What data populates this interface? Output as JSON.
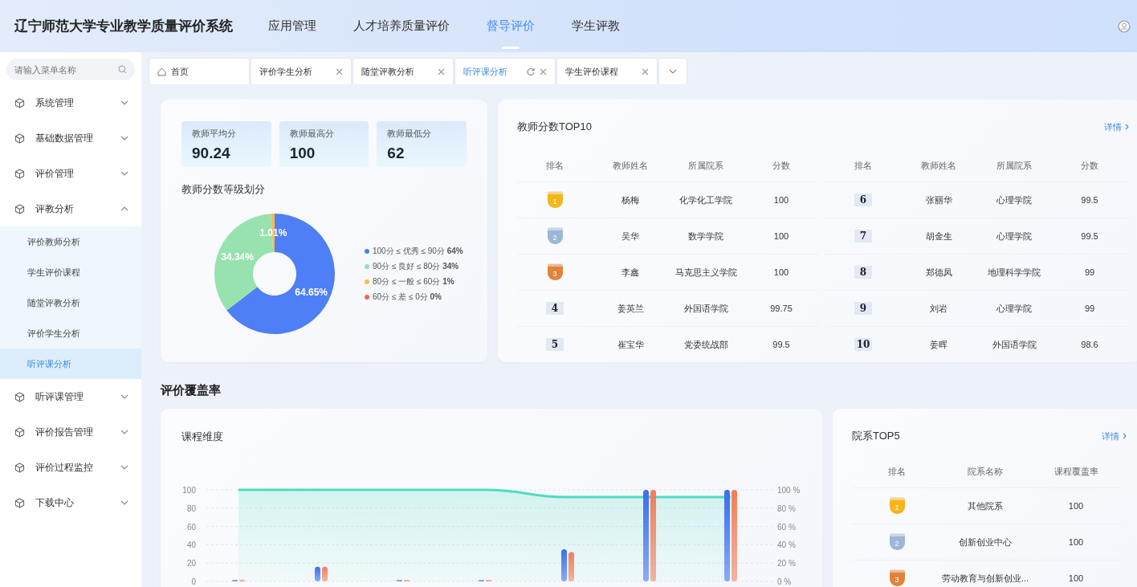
{
  "header": {
    "title": "辽宁师范大学专业教学质量评价系统",
    "nav": [
      {
        "label": "应用管理",
        "selected": false
      },
      {
        "label": "人才培养质量评价",
        "selected": false
      },
      {
        "label": "督导评价",
        "selected": true
      },
      {
        "label": "学生评教",
        "selected": false
      }
    ]
  },
  "sidebar": {
    "search": {
      "placeholder": "请输入菜单名称"
    },
    "items": [
      {
        "label": "系统管理",
        "expanded": false
      },
      {
        "label": "基础数据管理",
        "expanded": false
      },
      {
        "label": "评价管理",
        "expanded": false
      },
      {
        "label": "评教分析",
        "expanded": true,
        "children": [
          {
            "label": "评价教师分析",
            "selected": false
          },
          {
            "label": "学生评价课程",
            "selected": false
          },
          {
            "label": "随堂评教分析",
            "selected": false
          },
          {
            "label": "评价学生分析",
            "selected": false
          },
          {
            "label": "听评课分析",
            "selected": true
          }
        ]
      },
      {
        "label": "听评课管理",
        "expanded": false
      },
      {
        "label": "评价报告管理",
        "expanded": false
      },
      {
        "label": "评价过程监控",
        "expanded": false
      },
      {
        "label": "下载中心",
        "expanded": false
      }
    ]
  },
  "tabs": [
    {
      "label": "首页",
      "kind": "home",
      "selected": false
    },
    {
      "label": "评价学生分析",
      "kind": "closable",
      "selected": false
    },
    {
      "label": "随堂评教分析",
      "kind": "closable",
      "selected": false
    },
    {
      "label": "听评课分析",
      "kind": "closable",
      "selected": true
    },
    {
      "label": "学生评价课程",
      "kind": "closable",
      "selected": false
    }
  ],
  "quality": {
    "stats": [
      {
        "label": "教师平均分",
        "value": "90.24"
      },
      {
        "label": "教师最高分",
        "value": "100"
      },
      {
        "label": "教师最低分",
        "value": "62"
      }
    ],
    "grade_title": "教师分数等级划分",
    "chart_data": {
      "type": "donut",
      "values": [
        64.65,
        34.34,
        1.01,
        0
      ],
      "value_labels": [
        "64.65%",
        "34.34%",
        "1.01%",
        null
      ]
    },
    "legend": [
      {
        "label": "100分 ≤ 优秀 ≤ 90分 **64%**",
        "color": "#4f7ff6"
      },
      {
        "label": "90分 ≤ 良好 ≤ 80分 **34%**",
        "color": "#97e2ae"
      },
      {
        "label": "80分 ≤ 一般 ≤ 60分 **1%**",
        "color": "#f8bb4f"
      },
      {
        "label": "60分 ≤ 差 ≤ 0分 **0%**",
        "color": "#f2684c"
      }
    ]
  },
  "top10": {
    "title": "教师分数TOP10",
    "link": "详情",
    "columns": [
      "排名",
      "教师姓名",
      "所属院系",
      "分数",
      "排名",
      "教师姓名",
      "所属院系",
      "分数"
    ],
    "rows": [
      {
        "rank": "1",
        "name": "杨梅",
        "dept": "化学化工学院",
        "score": "100",
        "color": "#f5b51c"
      },
      {
        "rank": "2",
        "name": "吴华",
        "dept": "数学学院",
        "score": "100",
        "color": "#9db6d6"
      },
      {
        "rank": "3",
        "name": "李鑫",
        "dept": "马克思主义学院",
        "score": "100",
        "color": "#e0843a"
      },
      {
        "rank": "4",
        "name": "姜英兰",
        "dept": "外国语学院",
        "score": "99.75"
      },
      {
        "rank": "5",
        "name": "崔宝华",
        "dept": "党委统战部",
        "score": "99.5"
      },
      {
        "rank": "6",
        "name": "张丽华",
        "dept": "心理学院",
        "score": "99.5"
      },
      {
        "rank": "7",
        "name": "胡金生",
        "dept": "心理学院",
        "score": "99.5"
      },
      {
        "rank": "8",
        "name": "郑德凤",
        "dept": "地理科学学院",
        "score": "99"
      },
      {
        "rank": "9",
        "name": "刘岩",
        "dept": "心理学院",
        "score": "99"
      },
      {
        "rank": "10",
        "name": "姜晖",
        "dept": "外国语学院",
        "score": "98.6"
      }
    ]
  },
  "coverage": {
    "title": "评价覆盖率",
    "course": {
      "title": "课程维度",
      "chart_data": {
        "type": "bar",
        "ylim": [
          0,
          100
        ],
        "y2lim": [
          0,
          100
        ],
        "grid": true,
        "yticks": [
          0,
          20,
          40,
          60,
          80,
          100
        ],
        "y2ticks": [
          {
            "value": 0,
            "label": "0 %"
          },
          {
            "value": 20,
            "label": "20 %"
          },
          {
            "value": 40,
            "label": "40 %"
          },
          {
            "value": 60,
            "label": "60 %"
          },
          {
            "value": 80,
            "label": "80 %"
          },
          {
            "value": 100,
            "label": "100 %"
          }
        ],
        "series": [
          {
            "color": "#3b6ef0",
            "values": [
              1,
              16,
              1,
              1,
              35,
              100,
              100
            ]
          },
          {
            "color": "#f47c57",
            "values": [
              1,
              16,
              1,
              1,
              32,
              100,
              100
            ]
          },
          {
            "type": "area",
            "color": "#4fdcc0",
            "values": [
              100,
              100,
              100,
              100,
              92,
              92,
              92
            ]
          }
        ]
      }
    },
    "dept": {
      "title": "院系TOP5",
      "link": "详情",
      "columns": [
        "排名",
        "院系名称",
        "课程覆盖率"
      ],
      "rows": [
        {
          "rank": "1",
          "name": "其他院系",
          "rate": "100",
          "color": "#f5b51c"
        },
        {
          "rank": "2",
          "name": "创新创业中心",
          "rate": "100",
          "color": "#9db6d6"
        },
        {
          "rank": "3",
          "name": "劳动教育与创新创业...",
          "rate": "100",
          "color": "#e0843a"
        }
      ]
    }
  }
}
